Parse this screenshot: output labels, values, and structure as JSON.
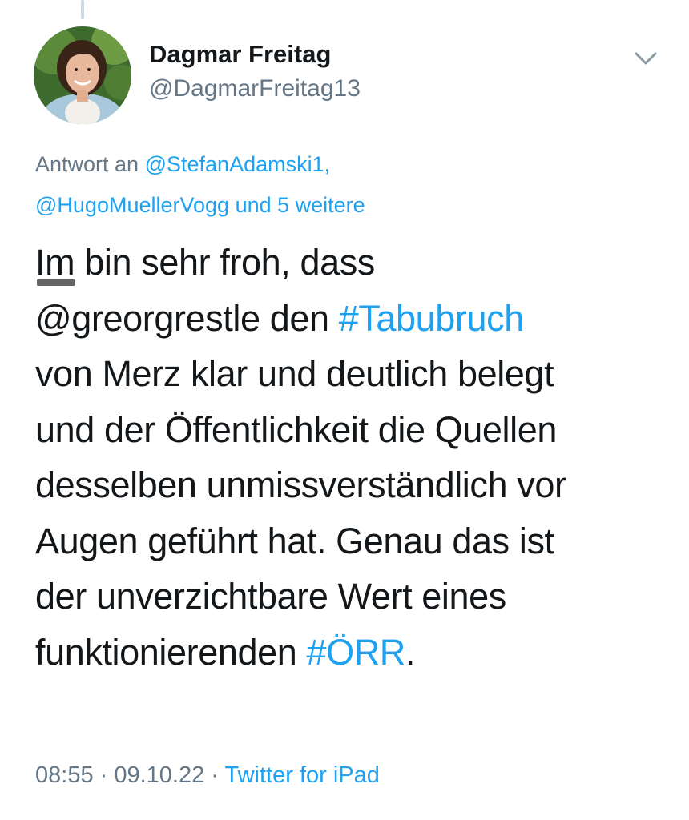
{
  "author": {
    "display_name": "Dagmar Freitag",
    "handle": "@DagmarFreitag13"
  },
  "reply": {
    "prefix": "Antwort an",
    "mention1": "@StefanAdamski1,",
    "mention2": "@HugoMuellerVogg",
    "suffix": "und 5 weitere"
  },
  "tweet": {
    "line1_word": "Im",
    "line1_rest": " bin sehr froh, dass",
    "line2_mention": "@greorgrestle",
    "line2_mid": " den ",
    "line2_hashtag": "#Tabubruch",
    "line3": "von Merz klar und deutlich belegt",
    "line4": "und der Öffentlichkeit die Quellen",
    "line5": "desselben unmissverständlich vor",
    "line6": "Augen geführt hat. Genau das ist",
    "line7": "der unverzichtbare Wert eines",
    "line8_text": "funktionierenden ",
    "line8_hashtag": "#ÖRR",
    "line8_end": "."
  },
  "meta": {
    "time": "08:55",
    "separator": " · ",
    "date": "09.10.22",
    "source": "Twitter for iPad"
  },
  "icons": {
    "caret": "chevron-down-icon",
    "avatar": "profile-photo"
  },
  "colors": {
    "link": "#1da1f2",
    "secondary": "#657786",
    "text": "#14171a"
  }
}
